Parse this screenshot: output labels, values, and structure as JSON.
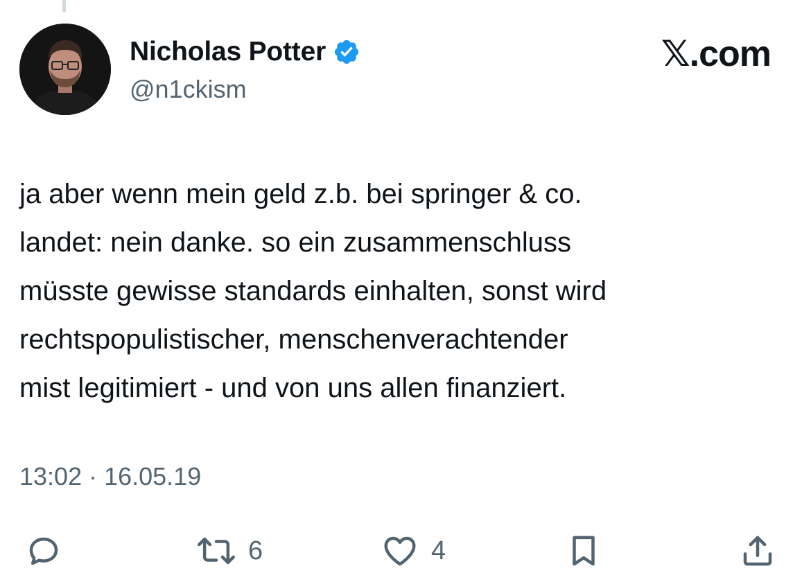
{
  "author": {
    "display_name": "Nicholas Potter",
    "handle": "@n1ckism",
    "verified": true,
    "verified_icon": "verified-badge-icon",
    "avatar_icon": "avatar-photo"
  },
  "brand": {
    "label": "𝕏.com"
  },
  "tweet": {
    "text": "ja aber wenn mein geld z.b. bei springer & co.\nlandet: nein danke. so ein zusammenschluss\nmüsste gewisse standards einhalten, sonst wird\nrechtspopulistischer, menschenverachtender\nmist legitimiert - und von uns allen finanziert.",
    "timestamp": "13:02 · 16.05.19"
  },
  "actions": {
    "reply": {
      "icon": "reply-icon"
    },
    "retweet": {
      "icon": "retweet-icon",
      "count": "6"
    },
    "like": {
      "icon": "heart-icon",
      "count": "4"
    },
    "bookmark": {
      "icon": "bookmark-icon"
    },
    "share": {
      "icon": "share-icon"
    }
  },
  "colors": {
    "text_primary": "#0f1419",
    "text_secondary": "#536471",
    "verified_blue": "#1d9bf0",
    "background": "#ffffff"
  }
}
